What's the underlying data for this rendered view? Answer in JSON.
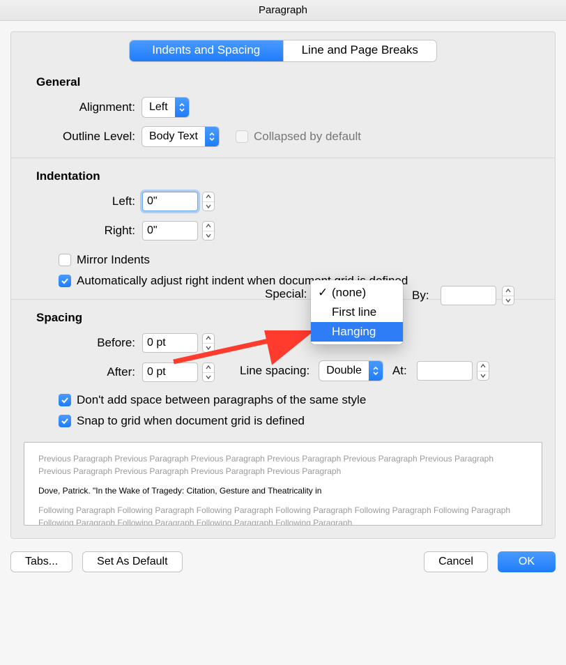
{
  "window_title": "Paragraph",
  "tabs": {
    "indents": "Indents and Spacing",
    "line": "Line and Page Breaks"
  },
  "general": {
    "title": "General",
    "alignment_label": "Alignment:",
    "alignment_value": "Left",
    "outline_label": "Outline Level:",
    "outline_value": "Body Text",
    "collapsed_label": "Collapsed by default"
  },
  "indentation": {
    "title": "Indentation",
    "left_label": "Left:",
    "left_value": "0\"",
    "right_label": "Right:",
    "right_value": "0\"",
    "special_label": "Special:",
    "by_label": "By:",
    "by_value": "",
    "mirror_label": "Mirror Indents",
    "auto_label": "Automatically adjust right indent when document grid is defined",
    "special_options": {
      "none": "(none)",
      "first": "First line",
      "hanging": "Hanging"
    }
  },
  "spacing": {
    "title": "Spacing",
    "before_label": "Before:",
    "before_value": "0 pt",
    "after_label": "After:",
    "after_value": "0 pt",
    "line_label": "Line spacing:",
    "line_value": "Double",
    "at_label": "At:",
    "at_value": "",
    "dont_add_label": "Don't add space between paragraphs of the same style",
    "snap_label": "Snap to grid when document grid is defined"
  },
  "preview": {
    "prev": "Previous Paragraph Previous Paragraph Previous Paragraph Previous Paragraph Previous Paragraph Previous Paragraph Previous Paragraph Previous Paragraph Previous Paragraph Previous Paragraph",
    "sample": "Dove, Patrick. \"In the Wake of Tragedy: Citation, Gesture and Theatricality in",
    "next": "Following Paragraph Following Paragraph Following Paragraph Following Paragraph Following Paragraph Following Paragraph Following Paragraph Following Paragraph Following Paragraph Following Paragraph"
  },
  "buttons": {
    "tabs": "Tabs...",
    "default": "Set As Default",
    "cancel": "Cancel",
    "ok": "OK"
  }
}
